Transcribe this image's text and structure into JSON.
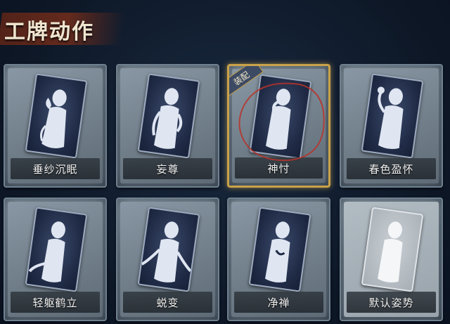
{
  "header": {
    "title": "工牌动作"
  },
  "cards": [
    {
      "label": "垂纱沉眠",
      "pose": "hand-to-chin",
      "selected": false
    },
    {
      "label": "妄尊",
      "pose": "hand-on-hip",
      "selected": false
    },
    {
      "label": "神忖",
      "pose": "thinking",
      "selected": true,
      "badge": "装配"
    },
    {
      "label": "春色盈怀",
      "pose": "holding-flower",
      "selected": false
    },
    {
      "label": "轻躯鹤立",
      "pose": "crane-stance",
      "selected": false
    },
    {
      "label": "蜕变",
      "pose": "arms-open",
      "selected": false
    },
    {
      "label": "净禅",
      "pose": "meditation",
      "selected": false
    },
    {
      "label": "默认姿势",
      "pose": "default",
      "selected": false
    }
  ],
  "colors": {
    "selected_border": "#c9a24a",
    "scribble": "#b8322a",
    "title_brush": "#6e2c1c"
  }
}
